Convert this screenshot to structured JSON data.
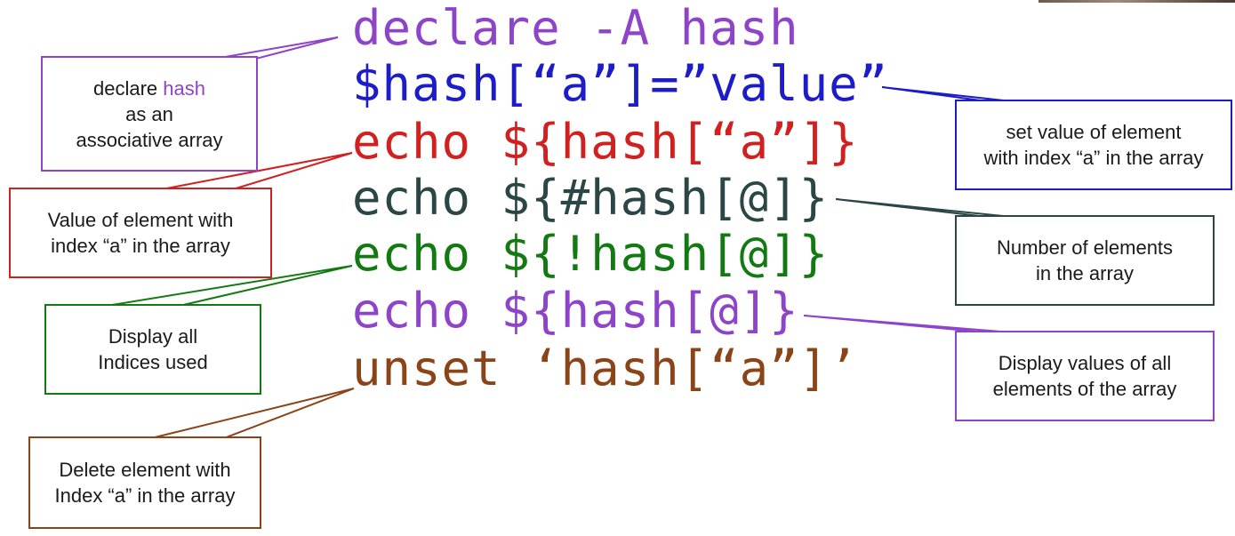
{
  "colors": {
    "purple": "#8e44c9",
    "blue": "#1c1cc8",
    "red": "#d02020",
    "slate": "#2b4646",
    "green": "#137a13",
    "brown": "#8a4418",
    "text": "#1a1a1a"
  },
  "code_lines": [
    "declare -A hash",
    "$hash[“a”]=”value”",
    "echo ${hash[“a”]}",
    "echo ${#hash[@]}",
    "echo ${!hash[@]}",
    "echo ${hash[@]}",
    "unset ‘hash[“a”]’"
  ],
  "callouts": {
    "declare": {
      "line1": "declare",
      "highlight": "hash",
      "line2": "as an",
      "line3": "associative array"
    },
    "set_value": {
      "line1": "set value of element",
      "line2": "with index “a” in the array"
    },
    "value_of": {
      "line1": "Value of element with",
      "line2": "index “a” in the array"
    },
    "count": {
      "line1": "Number of elements",
      "line2": "in the array"
    },
    "indices": {
      "line1": "Display all",
      "line2": "Indices used"
    },
    "values": {
      "line1": "Display values of all",
      "line2": "elements of the array"
    },
    "delete": {
      "line1": "Delete element with",
      "line2": "Index “a” in the array"
    }
  }
}
